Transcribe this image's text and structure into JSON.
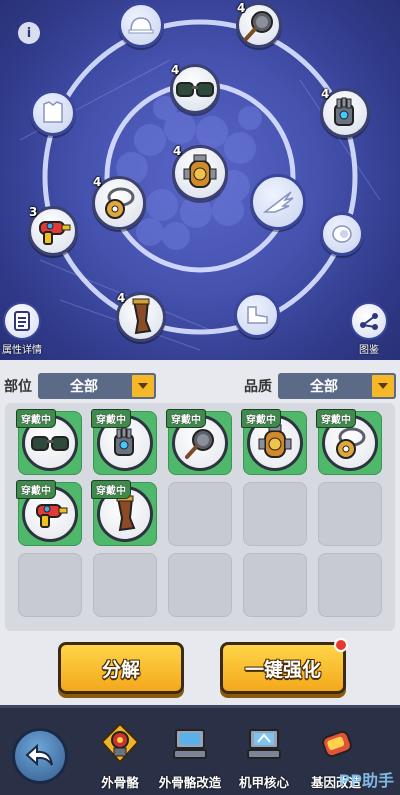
{
  "wheel": {
    "info_icon": "info-icon",
    "slot_levels": {
      "frying_pan": "4",
      "goggles": "4",
      "power_glove": "4",
      "core_pump": "4",
      "chain_gear": "4",
      "water_gun": "3",
      "boots": "4"
    },
    "attr_details_label": "属性详情",
    "catalog_label": "图鉴"
  },
  "filters": {
    "part_label": "部位",
    "part_value": "全部",
    "quality_label": "品质",
    "quality_value": "全部"
  },
  "inventory": {
    "equipped_tag": "穿戴中",
    "items": [
      {
        "name": "goggles",
        "equipped": true
      },
      {
        "name": "power-glove",
        "equipped": true
      },
      {
        "name": "frying-pan",
        "equipped": true
      },
      {
        "name": "core-pump",
        "equipped": true
      },
      {
        "name": "chain-gear",
        "equipped": true
      },
      {
        "name": "water-gun",
        "equipped": true
      },
      {
        "name": "boots",
        "equipped": true
      }
    ]
  },
  "actions": {
    "decompose": "分解",
    "one_click_upgrade": "一键强化"
  },
  "bottom_nav": {
    "items": [
      {
        "label": "外骨骼",
        "icon": "exoskeleton-icon"
      },
      {
        "label": "外骨骼改造",
        "icon": "exoskeleton-modify-icon"
      },
      {
        "label": "机甲核心",
        "icon": "mecha-core-icon"
      },
      {
        "label": "基因改造",
        "icon": "gene-modify-icon"
      }
    ]
  },
  "watermark": "PP助手",
  "colors": {
    "accent_gold": "#f5b828",
    "equipped_green": "#4fb86a",
    "badge_red": "#e63a2f"
  }
}
